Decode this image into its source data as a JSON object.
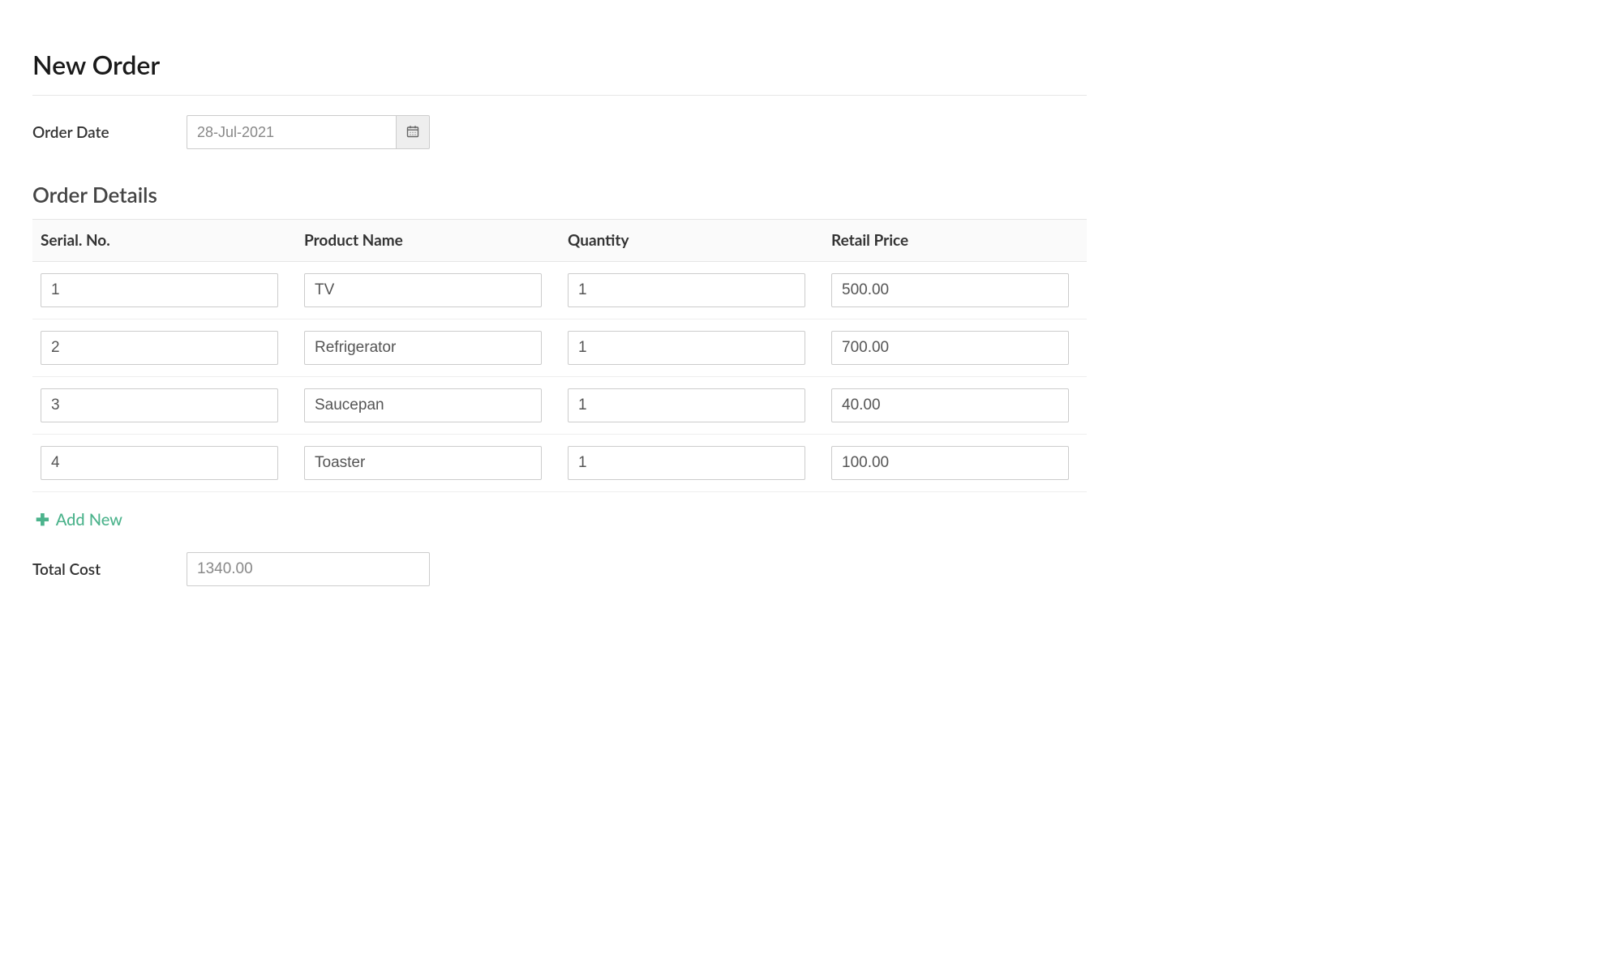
{
  "page": {
    "title": "New Order"
  },
  "order_date": {
    "label": "Order Date",
    "value": "28-Jul-2021"
  },
  "details": {
    "heading": "Order Details",
    "columns": {
      "serial": "Serial. No.",
      "product": "Product Name",
      "quantity": "Quantity",
      "price": "Retail Price"
    },
    "rows": [
      {
        "serial": "1",
        "product": "TV",
        "quantity": "1",
        "price": "500.00"
      },
      {
        "serial": "2",
        "product": "Refrigerator",
        "quantity": "1",
        "price": "700.00"
      },
      {
        "serial": "3",
        "product": "Saucepan",
        "quantity": "1",
        "price": "40.00"
      },
      {
        "serial": "4",
        "product": "Toaster",
        "quantity": "1",
        "price": "100.00"
      }
    ]
  },
  "add_new": {
    "label": "Add New"
  },
  "total": {
    "label": "Total Cost",
    "value": "1340.00"
  }
}
